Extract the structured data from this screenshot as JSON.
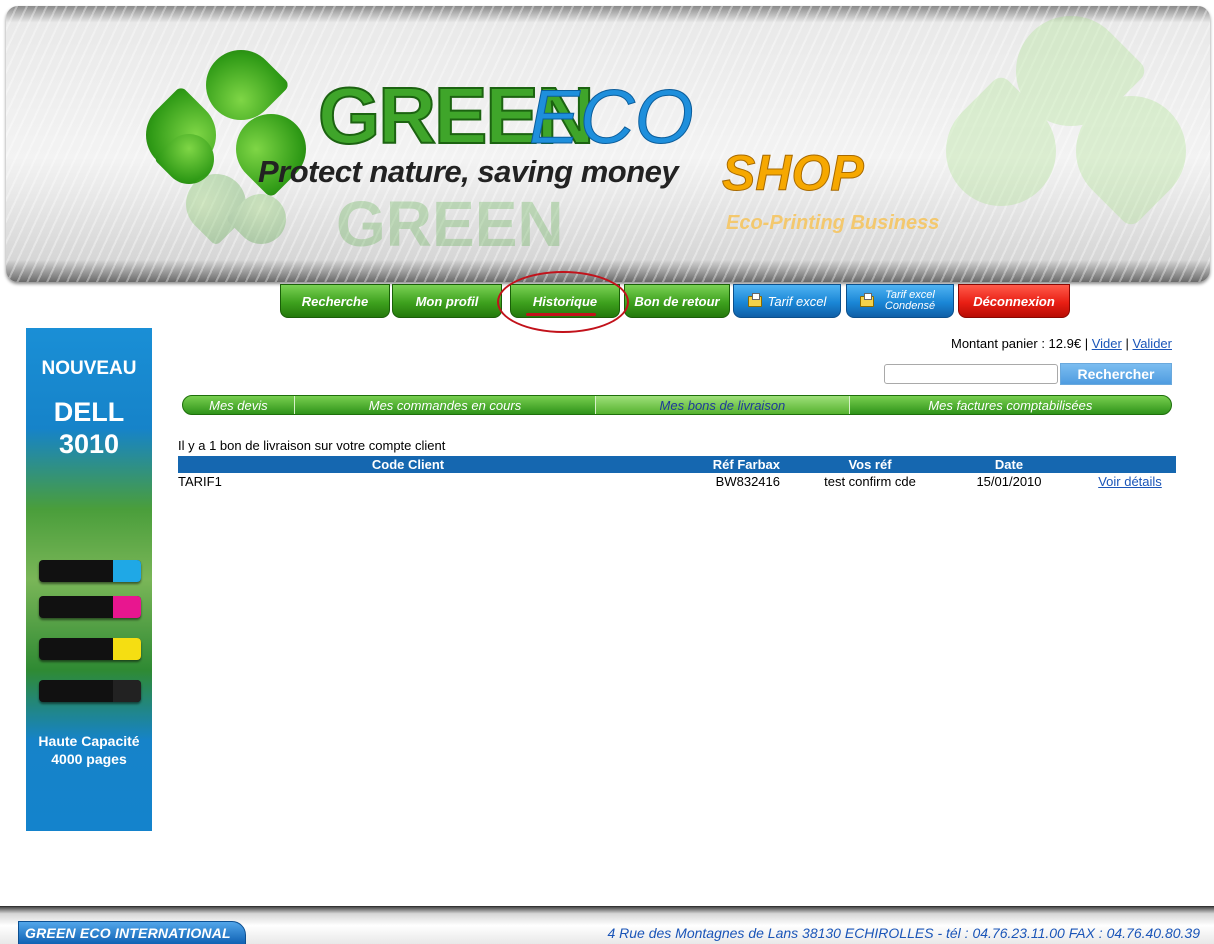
{
  "banner": {
    "brand_part1": "GREEN",
    "brand_part2": "ECO",
    "slogan": "Protect nature, saving money",
    "shop": "SHOP",
    "tagline": "Eco-Printing Business"
  },
  "topnav": [
    {
      "label": "Recherche",
      "style": "green",
      "icon": null
    },
    {
      "label": "Mon profil",
      "style": "green",
      "icon": null
    },
    {
      "label": "Historique",
      "style": "green",
      "icon": null
    },
    {
      "label": "Bon de retour",
      "style": "green",
      "icon": null
    },
    {
      "label": "Tarif excel",
      "style": "blue",
      "icon": "folder-icon"
    },
    {
      "label": "Tarif excel Condensé",
      "style": "blue",
      "icon": "folder-icon"
    },
    {
      "label": "Déconnexion",
      "style": "red",
      "icon": null
    }
  ],
  "annotation_color": "#c2121b",
  "ad": {
    "headline": "NOUVEAU",
    "model_line1": "DELL",
    "model_line2": "3010",
    "cap_line1": "Haute Capacité",
    "cap_line2": "4000 pages",
    "toner_colors": [
      "#1fa8e6",
      "#e8168f",
      "#f5de12",
      "#111111"
    ]
  },
  "cart": {
    "label": "Montant panier : 12.9€",
    "separator": "|",
    "empty_link": "Vider",
    "validate_link": "Valider"
  },
  "search": {
    "placeholder": "",
    "button_label": "Rechercher"
  },
  "subtabs": [
    {
      "label": "Mes devis",
      "active": false
    },
    {
      "label": "Mes commandes en cours",
      "active": false
    },
    {
      "label": "Mes bons de livraison",
      "active": true
    },
    {
      "label": "Mes factures comptabilisées",
      "active": false
    }
  ],
  "content": {
    "count_text": "Il y a 1 bon de livraison sur votre compte client",
    "headers": [
      "Code Client",
      "Réf Farbax",
      "Vos réf",
      "Date",
      ""
    ],
    "rows": [
      [
        "TARIF1",
        "BW832416",
        "test confirm cde",
        "15/01/2010",
        "Voir détails"
      ]
    ]
  },
  "footer": {
    "company": "GREEN ECO INTERNATIONAL",
    "address": "4 Rue des Montagnes de Lans 38130 ECHIROLLES - tél : 04.76.23.11.00 FAX : 04.76.40.80.39"
  },
  "colors": {
    "brand_green": "#3ea11e",
    "brand_blue": "#1567b0",
    "link_blue": "#1a55b8",
    "logout_red": "#e91f14",
    "shop_orange": "#f6a800"
  }
}
